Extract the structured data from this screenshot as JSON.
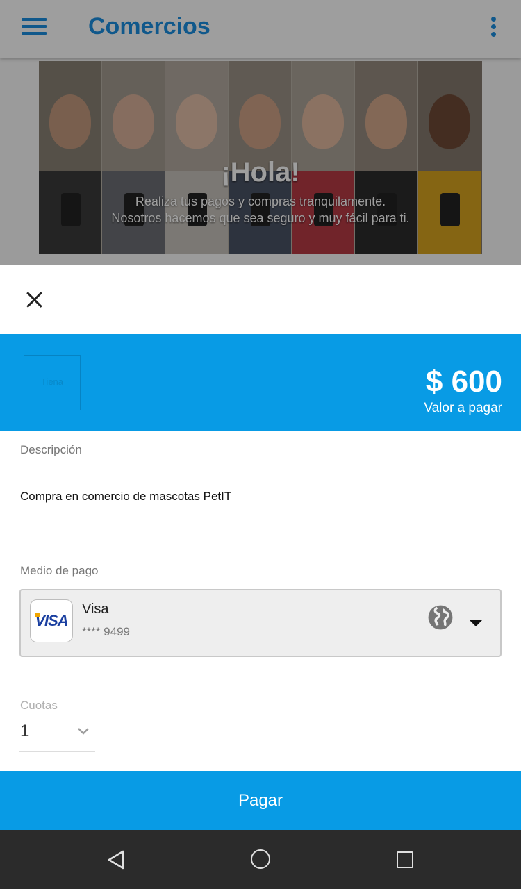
{
  "app": {
    "title": "Comercios",
    "accent_color": "#1a8fe0",
    "banner": {
      "greeting": "¡Hola!",
      "line1": "Realiza tus pagos y compras tranquilamente.",
      "line2": "Nosotros hacemos que sea seguro y muy fácil para ti."
    }
  },
  "sheet": {
    "close_icon": "close-icon",
    "merchant_logo_text": "Tiena",
    "amount": "$ 600",
    "amount_label": "Valor a pagar",
    "amount_band_color": "#089be5",
    "description_label": "Descripción",
    "description_value": "Compra en comercio de mascotas PetIT",
    "payment_method_label": "Medio de pago",
    "payment_method": {
      "logo_text": "VISA",
      "name": "Visa",
      "number": "**** 9499",
      "icon": "globe-icon"
    },
    "installments_label": "Cuotas",
    "installments_value": "1",
    "pay_button": "Pagar"
  },
  "navbar": {
    "back_icon": "back-triangle-icon",
    "home_icon": "home-circle-icon",
    "recents_icon": "recents-square-icon"
  }
}
